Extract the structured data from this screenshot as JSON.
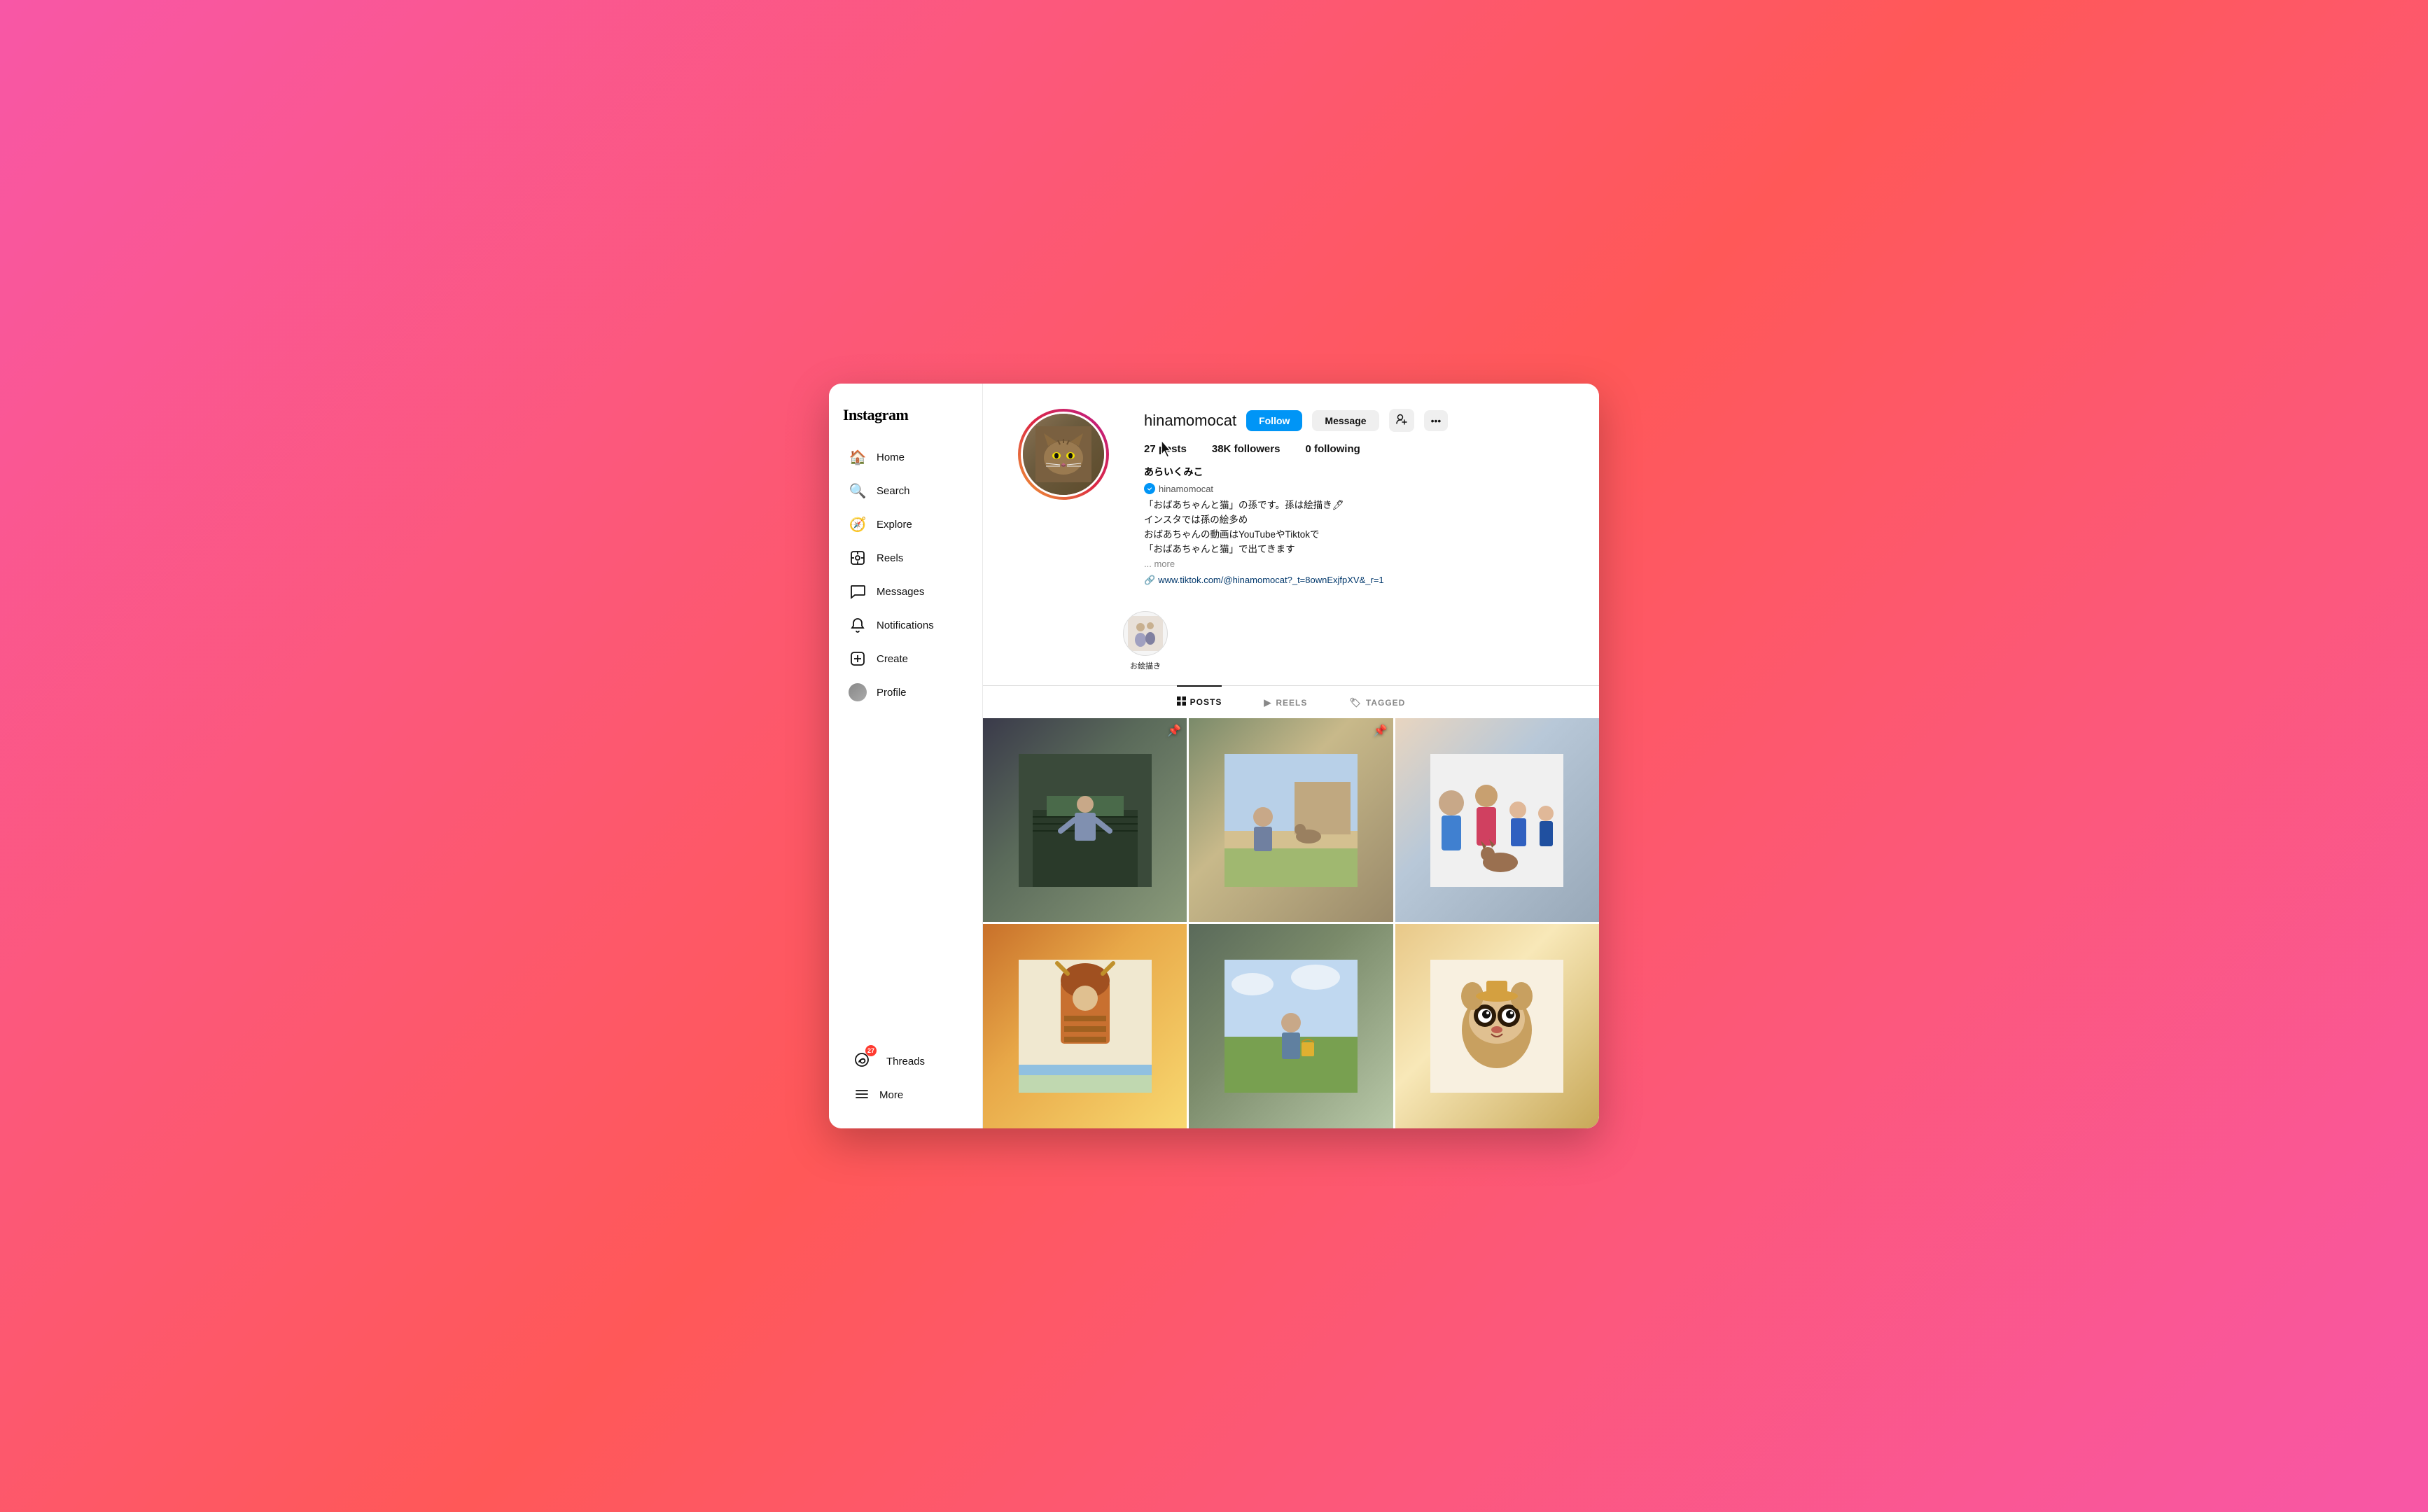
{
  "app": {
    "name": "Instagram"
  },
  "sidebar": {
    "logo": "Instagram",
    "nav_items": [
      {
        "id": "home",
        "label": "Home",
        "icon": "🏠"
      },
      {
        "id": "search",
        "label": "Search",
        "icon": "🔍"
      },
      {
        "id": "explore",
        "label": "Explore",
        "icon": "🧭"
      },
      {
        "id": "reels",
        "label": "Reels",
        "icon": "▶"
      },
      {
        "id": "messages",
        "label": "Messages",
        "icon": "✉"
      },
      {
        "id": "notifications",
        "label": "Notifications",
        "icon": "♡"
      },
      {
        "id": "create",
        "label": "Create",
        "icon": "⊕"
      },
      {
        "id": "profile",
        "label": "Profile",
        "icon": "👤"
      }
    ],
    "threads_label": "Threads",
    "threads_badge": "27",
    "more_label": "More"
  },
  "profile": {
    "username": "hinamomocat",
    "follow_label": "Follow",
    "message_label": "Message",
    "stats": {
      "posts_count": "27",
      "posts_label": "posts",
      "followers_count": "38K",
      "followers_label": "followers",
      "following_count": "0",
      "following_label": "following"
    },
    "display_name": "あらいくみこ",
    "verified_handle": "hinamomocat",
    "bio_lines": [
      "「おばあちゃんと猫」の孫です。孫は絵描き🖊",
      "インスタでは孫の絵多め",
      "おばあちゃんの動画はYouTubeやTiktokで",
      "「おばあちゃんと猫」で出てきます"
    ],
    "bio_more": "... more",
    "link_icon": "🔗",
    "link_text": "www.tiktok.com/@hinamomocat?_t=8ownExjfpXV&_r=1"
  },
  "highlights": [
    {
      "id": "oegaki",
      "label": "お絵描き",
      "icon": "🎨"
    }
  ],
  "tabs": [
    {
      "id": "posts",
      "label": "POSTS",
      "icon": "▦",
      "active": true
    },
    {
      "id": "reels",
      "label": "REELS",
      "icon": "▶",
      "active": false
    },
    {
      "id": "tagged",
      "label": "TAGGED",
      "icon": "🏷",
      "active": false
    }
  ],
  "posts": [
    {
      "id": 1,
      "pinned": true,
      "class": "post-1"
    },
    {
      "id": 2,
      "pinned": true,
      "class": "post-2"
    },
    {
      "id": 3,
      "pinned": false,
      "class": "post-3"
    },
    {
      "id": 4,
      "pinned": false,
      "class": "post-4"
    },
    {
      "id": 5,
      "pinned": false,
      "class": "post-5"
    },
    {
      "id": 6,
      "pinned": false,
      "class": "post-6"
    }
  ]
}
